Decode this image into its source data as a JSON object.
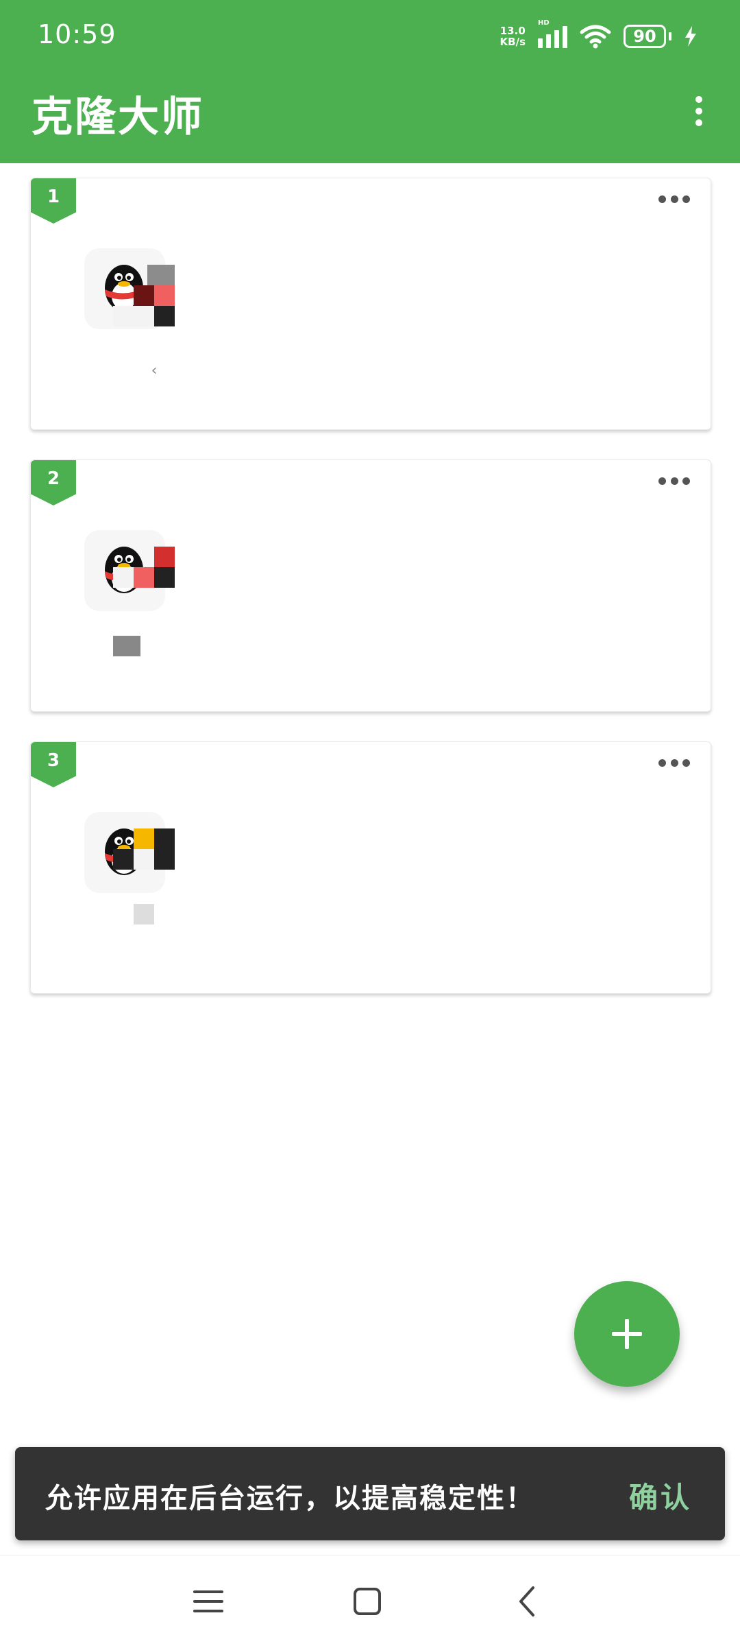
{
  "status_bar": {
    "time": "10:59",
    "net_speed_value": "13.0",
    "net_speed_unit": "KB/s",
    "network_badge": "HD",
    "battery": "90",
    "charging_icon": "bolt-icon"
  },
  "header": {
    "title": "克隆大师",
    "menu_icon": "more-vert-icon"
  },
  "cards": [
    {
      "index": "1",
      "app_icon": "qq-penguin-icon",
      "more_icon": "more-horiz-icon"
    },
    {
      "index": "2",
      "app_icon": "qq-penguin-icon",
      "more_icon": "more-horiz-icon"
    },
    {
      "index": "3",
      "app_icon": "qq-penguin-icon",
      "more_icon": "more-horiz-icon"
    }
  ],
  "fab": {
    "icon": "plus-icon"
  },
  "snackbar": {
    "message": "允许应用在后台运行，以提高稳定性！",
    "action": "确认",
    "action_color": "#8fd19e"
  },
  "nav_bar": {
    "menu_icon": "menu-icon",
    "home_icon": "home-square-icon",
    "back_icon": "back-chevron-icon"
  },
  "colors": {
    "primary": "#4caf50",
    "snackbar_bg": "#333333"
  }
}
